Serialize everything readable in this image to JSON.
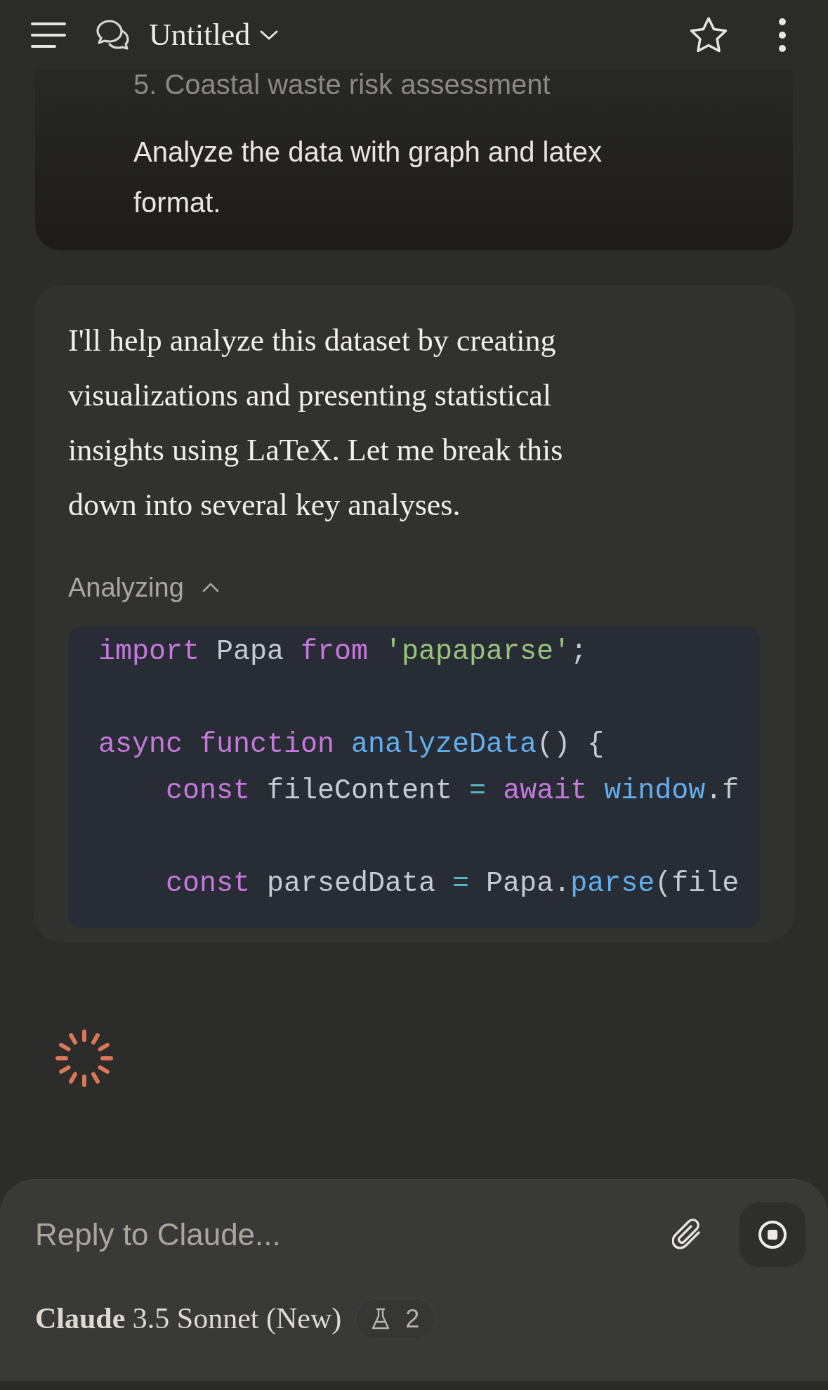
{
  "header": {
    "title": "Untitled"
  },
  "user_message": {
    "faded_line": "5. Coastal waste risk assessment",
    "text": "Analyze the data with graph and latex format."
  },
  "assistant_message": {
    "text": "I'll help analyze this dataset by creating visualizations and presenting statistical insights using LaTeX. Let me break this down into several key analyses.",
    "tool": {
      "label": "Analyzing",
      "expanded": true,
      "code_lines": [
        {
          "kind": "code",
          "tokens": [
            {
              "text": "import",
              "kind": "keyword"
            },
            {
              "text": " Papa ",
              "kind": "plain"
            },
            {
              "text": "from",
              "kind": "keyword"
            },
            {
              "text": " 'papaparse'",
              "kind": "string"
            },
            {
              "text": ";",
              "kind": "plain"
            }
          ]
        },
        {
          "kind": "blank"
        },
        {
          "kind": "code",
          "tokens": [
            {
              "text": "async",
              "kind": "keyword"
            },
            {
              "text": " function",
              "kind": "keyword"
            },
            {
              "text": " analyzeData",
              "kind": "function"
            },
            {
              "text": "() {",
              "kind": "plain"
            }
          ]
        },
        {
          "kind": "code",
          "tokens": [
            {
              "text": "    const",
              "kind": "keyword"
            },
            {
              "text": " fileContent ",
              "kind": "plain"
            },
            {
              "text": "=",
              "kind": "operator"
            },
            {
              "text": " await",
              "kind": "keyword"
            },
            {
              "text": " window",
              "kind": "function"
            },
            {
              "text": ".f",
              "kind": "plain"
            }
          ]
        },
        {
          "kind": "blank"
        },
        {
          "kind": "code",
          "tokens": [
            {
              "text": "    const",
              "kind": "keyword"
            },
            {
              "text": " parsedData ",
              "kind": "plain"
            },
            {
              "text": "=",
              "kind": "operator"
            },
            {
              "text": " Papa.",
              "kind": "plain"
            },
            {
              "text": "parse",
              "kind": "function"
            },
            {
              "text": "(file",
              "kind": "plain"
            }
          ]
        }
      ]
    }
  },
  "composer": {
    "placeholder": "Reply to Claude...",
    "model": "**Claude** 3.5 Sonnet (New)",
    "tools_count": "2"
  }
}
